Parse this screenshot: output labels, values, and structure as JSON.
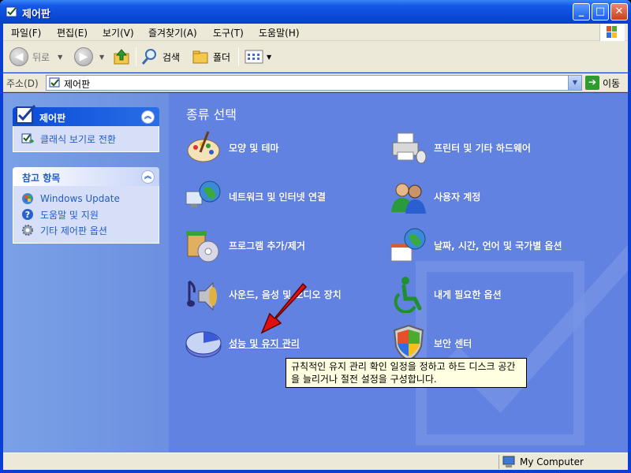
{
  "window": {
    "title": "제어판",
    "minimize": "_",
    "maximize": "□",
    "close": "✕"
  },
  "menu": [
    "파일(F)",
    "편집(E)",
    "보기(V)",
    "즐겨찾기(A)",
    "도구(T)",
    "도움말(H)"
  ],
  "toolbar": {
    "back": "뒤로",
    "search": "검색",
    "folders": "폴더"
  },
  "address": {
    "label": "주소(D)",
    "value": "제어판",
    "go": "이동"
  },
  "sidebar": {
    "control_panel": {
      "title": "제어판",
      "links": [
        {
          "label": "클래식 보기로 전환",
          "icon": "switch-view-icon"
        }
      ]
    },
    "see_also": {
      "title": "참고 항목",
      "links": [
        {
          "label": "Windows Update",
          "icon": "windows-update-icon"
        },
        {
          "label": "도움말 및 지원",
          "icon": "help-icon"
        },
        {
          "label": "기타 제어판 옵션",
          "icon": "gear-icon"
        }
      ]
    }
  },
  "main": {
    "section_title": "종류 선택",
    "categories": [
      {
        "label": "모양 및 테마",
        "icon": "appearance-themes-icon"
      },
      {
        "label": "프린터 및 기타 하드웨어",
        "icon": "printer-hardware-icon"
      },
      {
        "label": "네트워크 및 인터넷 연결",
        "icon": "network-internet-icon"
      },
      {
        "label": "사용자 계정",
        "icon": "user-accounts-icon"
      },
      {
        "label": "프로그램 추가/제거",
        "icon": "add-remove-programs-icon"
      },
      {
        "label": "날짜, 시간, 언어 및 국가별 옵션",
        "icon": "date-time-language-icon"
      },
      {
        "label": "사운드, 음성 및 오디오 장치",
        "icon": "sound-audio-icon"
      },
      {
        "label": "내게 필요한 옵션",
        "icon": "accessibility-icon"
      },
      {
        "label": "성능 및 유지 관리",
        "icon": "performance-maintenance-icon"
      },
      {
        "label": "보안 센터",
        "icon": "security-center-icon"
      }
    ],
    "tooltip": "규칙적인 유지 관리 확인 일정을 정하고 하드 디스크 공간을 늘리거나 절전 설정을 구성합니다."
  },
  "status": {
    "location": "My Computer"
  }
}
